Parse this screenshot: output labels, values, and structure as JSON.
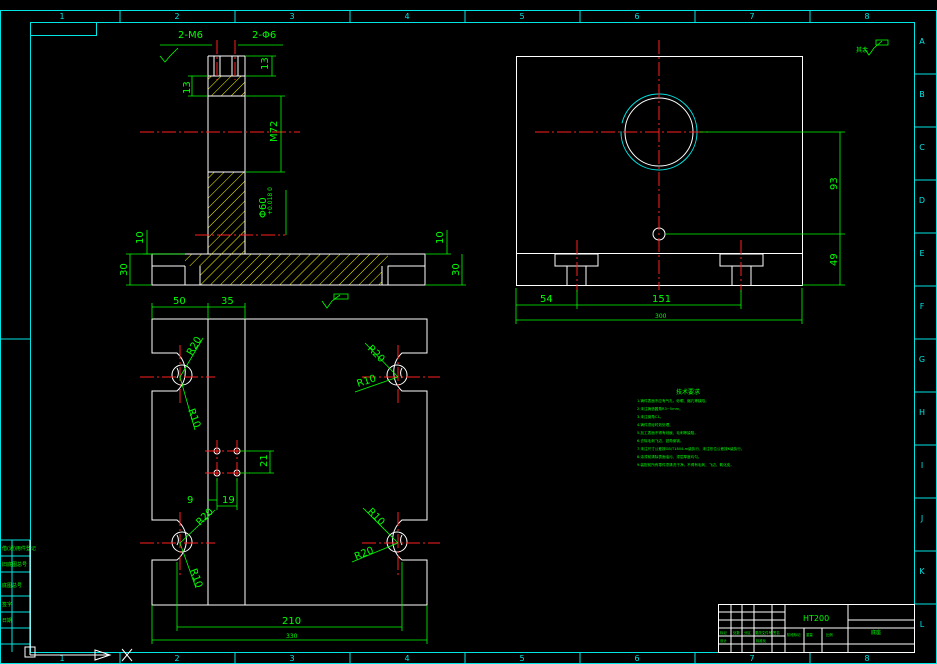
{
  "colors": {
    "background": "#000000",
    "border": "#00e5e5",
    "outline": "#ffffff",
    "center_line": "#ff2020",
    "dimension": "#00ff00",
    "hatch": "#ffff00",
    "table_text": "#00ff00"
  },
  "frame": {
    "top_zones": [
      "1",
      "2",
      "3",
      "4",
      "5",
      "6",
      "7",
      "8"
    ],
    "bottom_zones": [
      "1",
      "2",
      "3",
      "4",
      "5",
      "6",
      "7",
      "8"
    ],
    "side_zones": [
      "A",
      "B",
      "C",
      "D",
      "E",
      "F",
      "G",
      "H",
      "I",
      "J",
      "K",
      "L"
    ]
  },
  "front_view": {
    "dims": {
      "thread_label": "2-M6",
      "hole_label": "2-Φ6",
      "top_right": "13",
      "top_left": "13",
      "bore": "M72",
      "shaft": "Φ60",
      "shaft_tol": "+0.018 0",
      "foot_left_10": "10",
      "foot_left_30": "30",
      "foot_right_10": "10",
      "foot_right_30": "30"
    }
  },
  "side_view": {
    "dims": {
      "height_93": "93",
      "height_49": "49",
      "width_54": "54",
      "width_151": "151",
      "overall": "300"
    }
  },
  "top_view": {
    "dims": {
      "w50": "50",
      "w35": "35",
      "r20_tl": "R20",
      "r10_tl": "R10",
      "r20_tr": "R20",
      "r10_tr": "R10",
      "r20_bl": "R20",
      "r10_bl": "R10",
      "r10_br": "R10",
      "r20_br": "R20",
      "d21": "21",
      "d9": "9",
      "d19": "19",
      "d210": "210",
      "overall": "330"
    }
  },
  "notes": {
    "title": "技术要求",
    "lines": [
      "1.铸件表面不应有气孔、砂眼、缩孔等缺陷。",
      "2.未注铸造圆角R3~5mm。",
      "3.未注倒角C1。",
      "4.铸件须经时效处理。",
      "5.加工表面不得有划痕、毛刺等缺陷。",
      "6.去除毛刺飞边，锐角倒钝。",
      "7.未注尺寸公差按GB/T1804-m级执行，未注形位公差按K级执行。",
      "8.涂漆前清除表面油污，漆层厚度均匀。",
      "9.装配前所有零件须清洗干净，不得有毛刺、飞边、氧化皮。"
    ]
  },
  "title_block": {
    "material": "HT200",
    "row_labels": [
      "标记",
      "处数",
      "分区",
      "更改文件号",
      "签名",
      "年月日"
    ],
    "part_name": "底座",
    "cells": [
      "设计",
      "标准化",
      "阶段标记",
      "重量",
      "比例"
    ]
  },
  "left_strip": {
    "labels": [
      "借(通)用件登记",
      "旧底图总号",
      "底图总号",
      "签字",
      "日期"
    ]
  },
  "surface_marks": {
    "side_top": "其余"
  }
}
